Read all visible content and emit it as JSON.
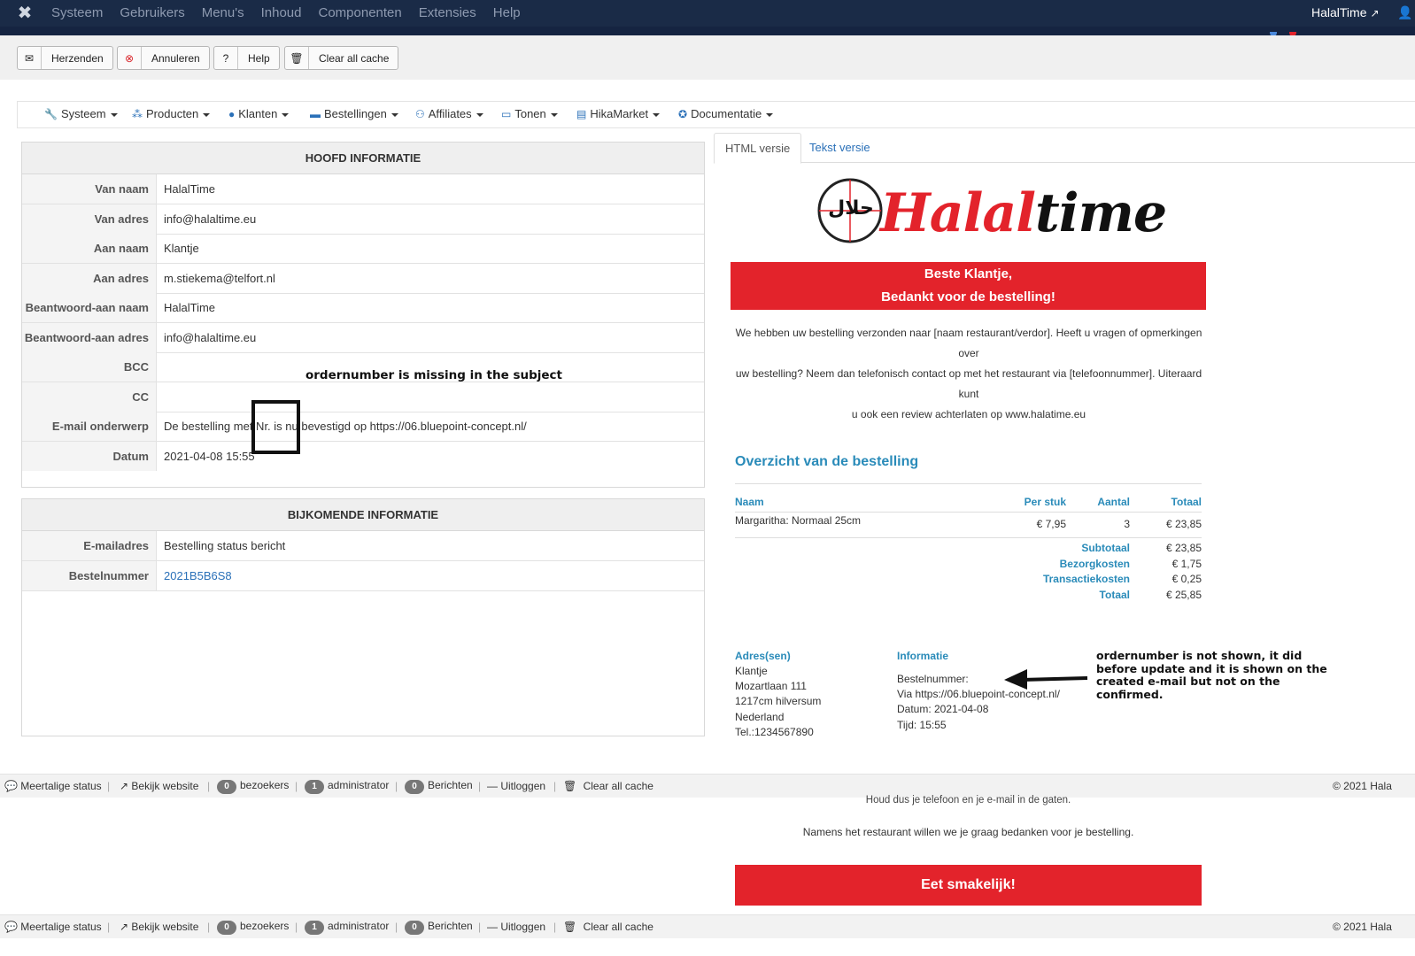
{
  "topnav": {
    "menu": [
      "Systeem",
      "Gebruikers",
      "Menu's",
      "Inhoud",
      "Componenten",
      "Extensies",
      "Help"
    ],
    "site_name": "HalalTime",
    "colors": {
      "bg": "#1a2b47",
      "dot1": "#4a89dc",
      "dot2": "#e3232b"
    }
  },
  "toolbar": {
    "send": "Herzenden",
    "cancel": "Annuleren",
    "help": "Help",
    "clear_cache": "Clear all cache"
  },
  "hikamenu": {
    "items": [
      "Systeem",
      "Producten",
      "Klanten",
      "Bestellingen",
      "Affiliates",
      "Tonen",
      "HikaMarket",
      "Documentatie"
    ]
  },
  "main_info": {
    "title": "HOOFD INFORMATIE",
    "rows": [
      {
        "label": "Van naam",
        "value": "HalalTime"
      },
      {
        "label": "Van adres",
        "value": "info@halaltime.eu"
      },
      {
        "label": "Aan naam",
        "value": "Klantje"
      },
      {
        "label": "Aan adres",
        "value": "m.stiekema@telfort.nl"
      },
      {
        "label": "Beantwoord-aan naam",
        "value": "HalalTime"
      },
      {
        "label": "Beantwoord-aan adres",
        "value": "info@halaltime.eu"
      },
      {
        "label": "BCC",
        "value": ""
      },
      {
        "label": "CC",
        "value": ""
      },
      {
        "label": "E-mail onderwerp",
        "value": "De bestelling met Nr. is nu bevestigd op https://06.bluepoint-concept.nl/"
      },
      {
        "label": "Datum",
        "value": "2021-04-08 15:55"
      }
    ]
  },
  "extra_info": {
    "title": "BIJKOMENDE INFORMATIE",
    "rows": [
      {
        "label": "E-mailadres",
        "value": "Bestelling status bericht"
      },
      {
        "label": "Bestelnummer",
        "value": "2021B5B6S8"
      }
    ]
  },
  "annotations": {
    "subject_note": "ordernumber is missing in the subject",
    "order_note": "ordernumber is not shown, it did before update and it is shown on the created e-mail but not on the confirmed."
  },
  "tabs": [
    "HTML versie",
    "Tekst versie"
  ],
  "email": {
    "logo_text_red": "Halal",
    "logo_text_black": "time",
    "logo_seal": "حلال",
    "greeting": "Beste Klantje,",
    "thanks": "Bedankt voor de bestelling!",
    "intro_1": "We hebben uw bestelling verzonden naar [naam restaurant/verdor].  Heeft u vragen of opmerkingen over",
    "intro_2": "uw bestelling? Neem dan telefonisch contact op met het restaurant via [telefoonnummer]. Uiteraard kunt",
    "intro_3": "u ook een review achterlaten op www.halatime.eu",
    "overview_title": "Overzicht van de bestelling",
    "columns": {
      "name": "Naam",
      "unit": "Per stuk",
      "qty": "Aantal",
      "total": "Totaal"
    },
    "items": [
      {
        "name": "Margaritha: Normaal 25cm",
        "unit": "€ 7,95",
        "qty": "3",
        "total": "€ 23,85"
      }
    ],
    "totals": [
      {
        "label": "Subtotaal",
        "value": "€ 23,85"
      },
      {
        "label": "Bezorgkosten",
        "value": "€ 1,75"
      },
      {
        "label": "Transactiekosten",
        "value": "€ 0,25"
      },
      {
        "label": "Totaal",
        "value": "€ 25,85"
      }
    ],
    "address_title": "Adres(sen)",
    "address": [
      "Klantje",
      "Mozartlaan 111",
      "1217cm hilversum",
      "Nederland",
      "Tel.:1234567890"
    ],
    "info_title": "Informatie",
    "info": [
      "Bestelnummer:",
      "Via https://06.bluepoint-concept.nl/",
      "Datum: 2021-04-08",
      "Tijd: 15:55"
    ],
    "footer_1": "Houd dus je telefoon en je e-mail in de gaten.",
    "footer_2": "Namens het restaurant willen we je graag bedanken voor je bestelling.",
    "enjoy": "Eet smakelijk!",
    "accent": "#e3232b"
  },
  "statusbar": {
    "multilang": "Meertalige status",
    "view_site": "Bekijk website",
    "visitors_count": "0",
    "visitors": "bezoekers",
    "admin_count": "1",
    "admin": "administrator",
    "messages_count": "0",
    "messages": "Berichten",
    "logout": "Uitloggen",
    "clear_cache": "Clear all cache",
    "copyright": "© 2021 Hala"
  }
}
